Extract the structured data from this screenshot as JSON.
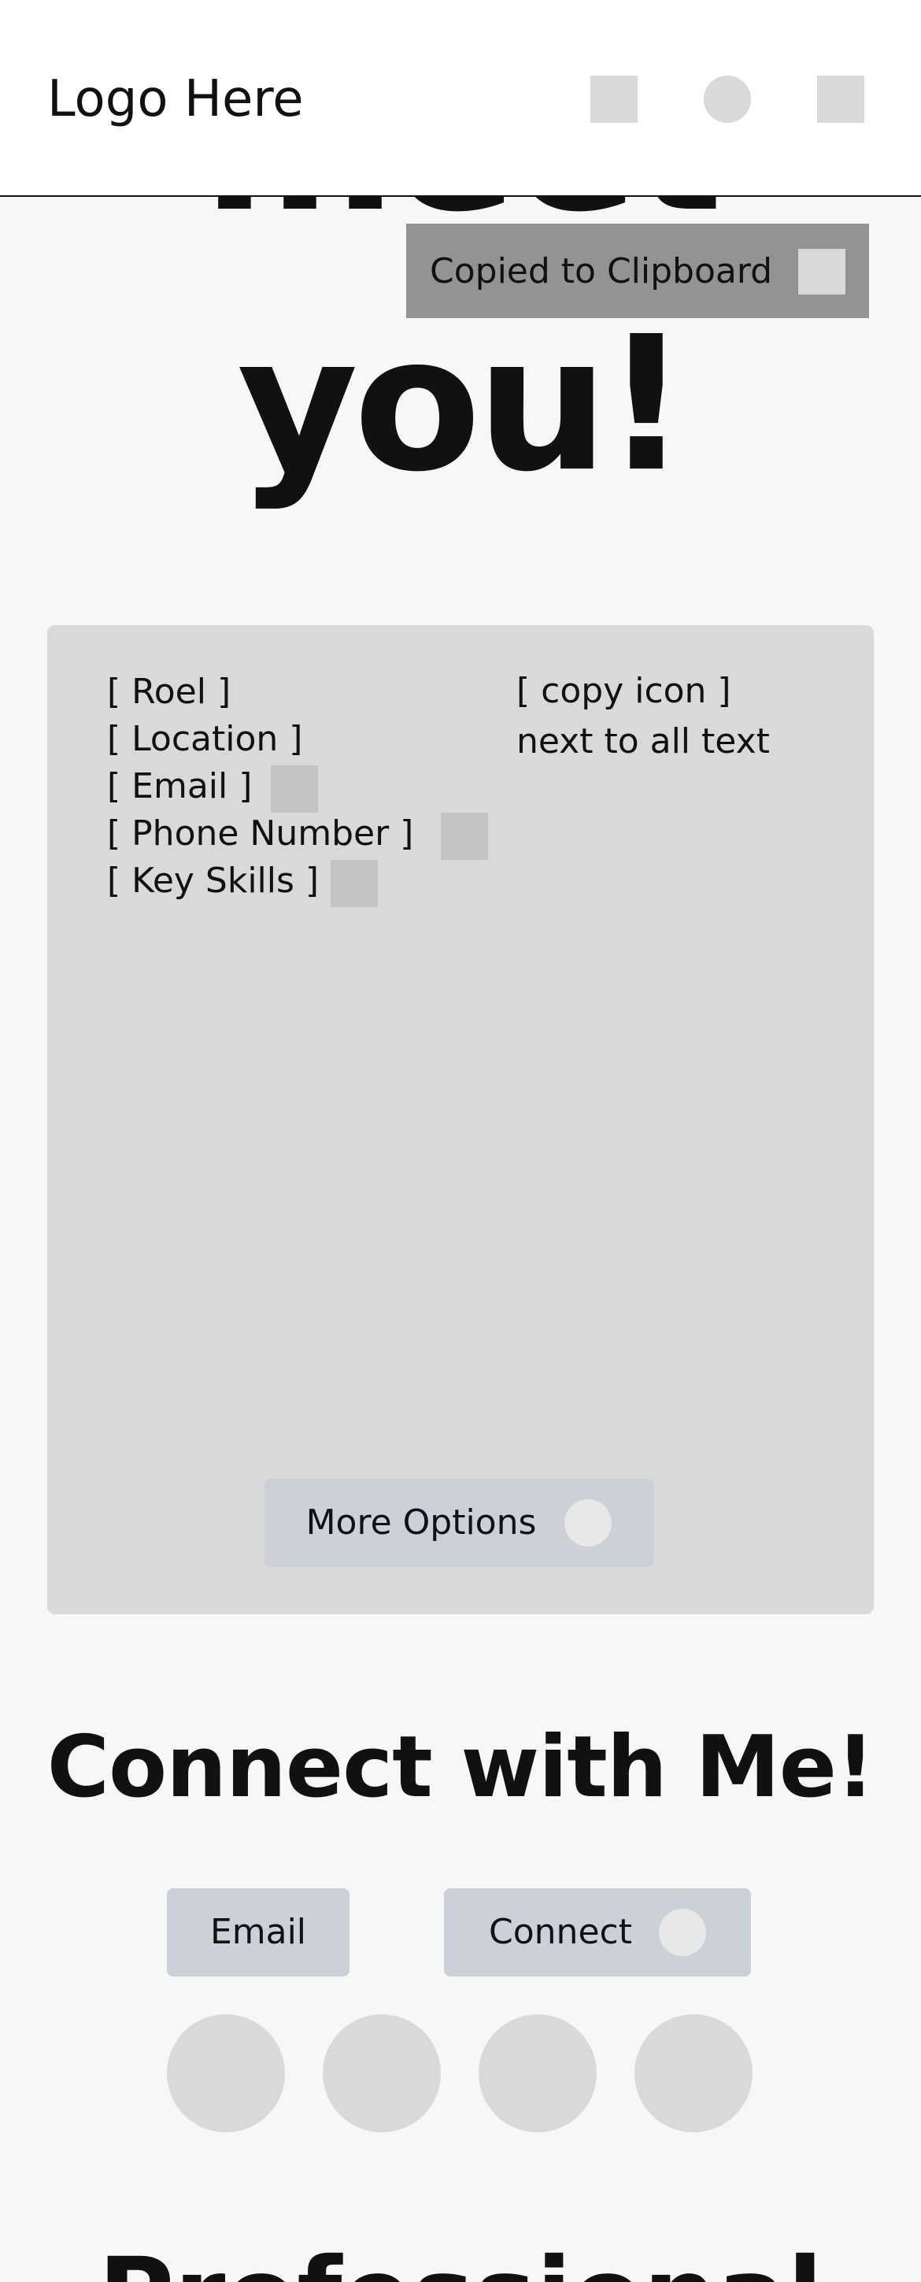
{
  "header": {
    "logo": "Logo Here",
    "icons": [
      "square-icon",
      "circle-icon",
      "square-icon"
    ]
  },
  "hero": {
    "line1": "meet",
    "line2": "you!"
  },
  "toast": {
    "text": "Copied to Clipboard",
    "close_icon": "square-icon"
  },
  "profile": {
    "items": [
      {
        "label": "[ Roel ]"
      },
      {
        "label": "[ Location ]"
      },
      {
        "label": "[ Email ]"
      },
      {
        "label": "[ Phone Number ]"
      },
      {
        "label": "[ Key Skills ]"
      }
    ],
    "note_line1": "[ copy icon ]",
    "note_line2": "next to all text",
    "more_options_label": "More Options"
  },
  "connect": {
    "title": "Connect with Me!",
    "email_label": "Email",
    "connect_label": "Connect",
    "social_icons": [
      "social-icon-1",
      "social-icon-2",
      "social-icon-3",
      "social-icon-4"
    ]
  },
  "next_section": {
    "title": "Professional"
  },
  "colors": {
    "page_bg": "#f7f7f7",
    "card_bg": "#d9d9d9",
    "button_bg": "#ccd0d8",
    "toast_bg": "#939393",
    "text": "#111111"
  }
}
